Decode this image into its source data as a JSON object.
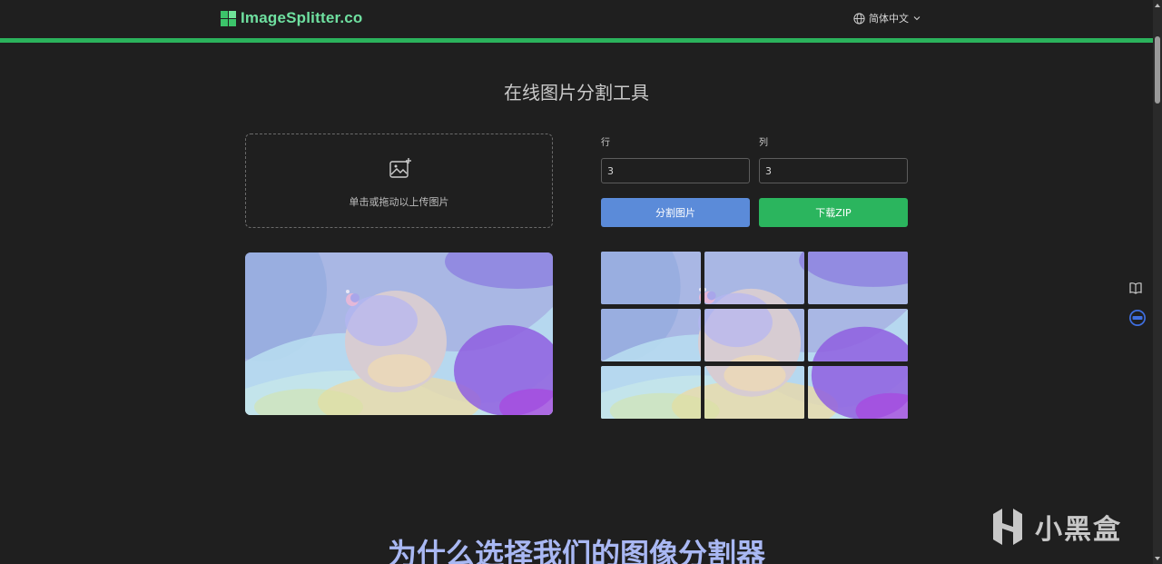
{
  "header": {
    "logo_text": "ImageSplitter.co",
    "language_label": "简体中文"
  },
  "colors": {
    "accent_green": "#2bb25c",
    "split_button": "#5b8bd9",
    "zip_button": "#2bb55e",
    "heading_blue": "#a9b8f3"
  },
  "main": {
    "title": "在线图片分割工具",
    "upload_hint": "单击或拖动以上传图片",
    "rows_label": "行",
    "rows_value": "3",
    "cols_label": "列",
    "cols_value": "3",
    "split_button": "分割图片",
    "zip_button": "下载ZIP"
  },
  "grid": {
    "rows": 3,
    "cols": 3
  },
  "section": {
    "title": "为什么选择我们的图像分割器"
  },
  "watermark": {
    "text": "小黑盒"
  },
  "icons": [
    "logo-grid-icon",
    "globe-icon",
    "chevron-down-icon",
    "image-plus-icon",
    "book-icon",
    "translate-icon"
  ]
}
